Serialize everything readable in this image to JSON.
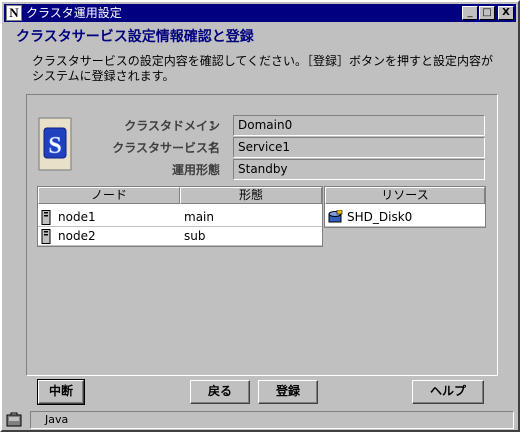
{
  "window": {
    "title": "クラスタ運用設定",
    "app_icon_letter": "N",
    "controls": {
      "minimize": "_",
      "maximize": "□",
      "close": "X"
    }
  },
  "header": {
    "title": "クラスタサービス設定情報確認と登録",
    "description_line1": "クラスタサービスの設定内容を確認してください。［登録］ボタンを押すと設定内容が",
    "description_line2": "システムに登録されます。"
  },
  "service_info": {
    "icon_letter": "S",
    "colon": ":",
    "fields": [
      {
        "label": "クラスタドメイン",
        "value": "Domain0"
      },
      {
        "label": "クラスタサービス名",
        "value": "Service1"
      },
      {
        "label": "運用形態",
        "value": "Standby"
      }
    ]
  },
  "node_table": {
    "columns": [
      "ノード",
      "形態"
    ],
    "rows": [
      {
        "node": "node1",
        "mode": "main"
      },
      {
        "node": "node2",
        "mode": "sub"
      }
    ]
  },
  "resource_table": {
    "column": "リソース",
    "rows": [
      {
        "name": "SHD_Disk0"
      }
    ]
  },
  "buttons": {
    "abort": "中断",
    "back": "戻る",
    "register": "登録",
    "help": "ヘルプ"
  },
  "statusbar": {
    "text": "Java"
  },
  "colors": {
    "title_bar": "#000080",
    "heading": "#000080",
    "face": "#c0c0c0"
  }
}
